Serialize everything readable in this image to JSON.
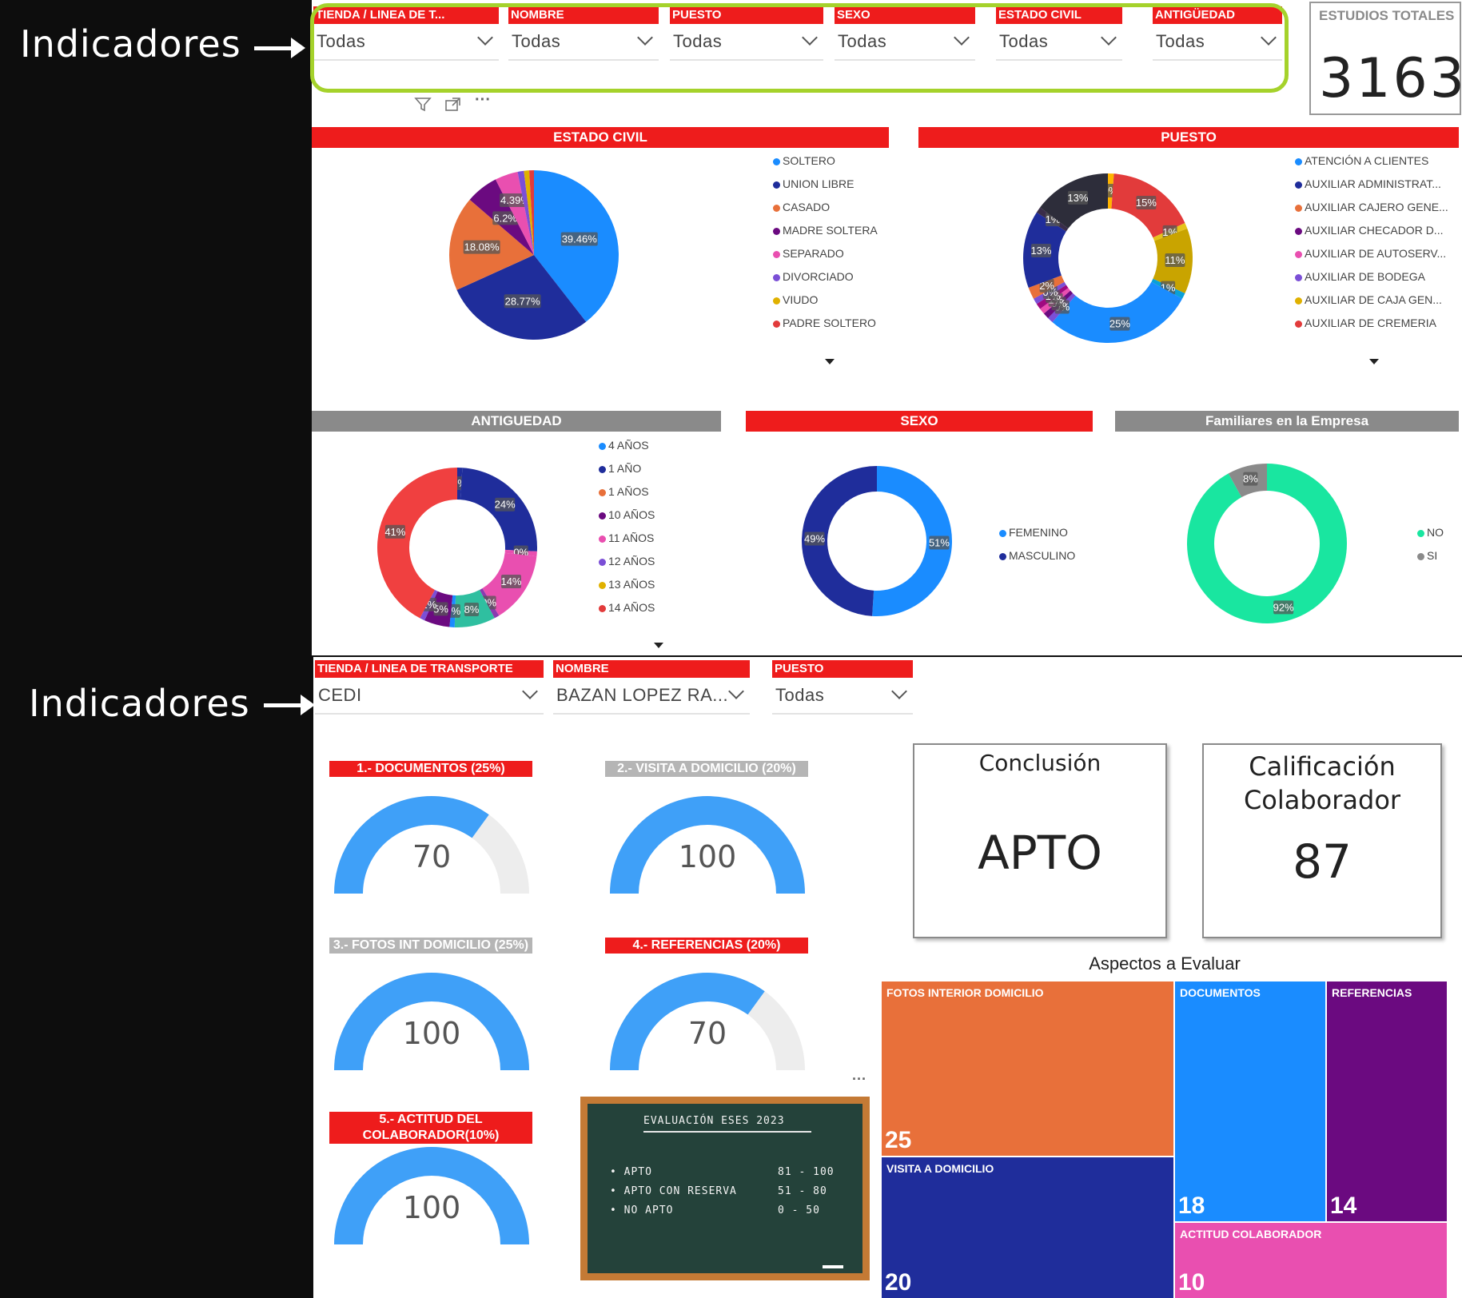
{
  "annotations": {
    "top": "Indicadores",
    "bottom": "Indicadores"
  },
  "top_filters": [
    {
      "header": "TIENDA / LINEA DE T...",
      "value": "Todas"
    },
    {
      "header": "NOMBRE",
      "value": "Todas"
    },
    {
      "header": "PUESTO",
      "value": "Todas"
    },
    {
      "header": "SEXO",
      "value": "Todas"
    },
    {
      "header": "ESTADO CIVIL",
      "value": "Todas"
    },
    {
      "header": "ANTIGÜEDAD",
      "value": "Todas"
    }
  ],
  "estudios": {
    "label": "ESTUDIOS TOTALES",
    "value": "3163"
  },
  "toolbar_more": "···",
  "estado_civil": {
    "title": "ESTADO CIVIL",
    "legend": [
      "SOLTERO",
      "UNION LIBRE",
      "CASADO",
      "MADRE SOLTERA",
      "SEPARADO",
      "DIVORCIADO",
      "VIUDO",
      "PADRE SOLTERO"
    ],
    "colors": [
      "#1a8cff",
      "#1f2d9b",
      "#e8703a",
      "#6b0a80",
      "#e94fb0",
      "#7b4fd6",
      "#e0b100",
      "#e23b3b"
    ],
    "labels": [
      "39.46%",
      "28.77%",
      "18.08%",
      "6.2%",
      "4.39%"
    ]
  },
  "puesto": {
    "title": "PUESTO",
    "legend": [
      "ATENCIÓN A CLIENTES",
      "AUXILIAR ADMINISTRAT...",
      "AUXILIAR CAJERO GENE...",
      "AUXILIAR CHECADOR D...",
      "AUXILIAR DE AUTOSERV...",
      "AUXILIAR DE BODEGA",
      "AUXILIAR DE CAJA GEN...",
      "AUXILIAR DE CREMERIA"
    ],
    "colors": [
      "#1a8cff",
      "#1f2d9b",
      "#e8703a",
      "#6b0a80",
      "#e94fb0",
      "#7b4fd6",
      "#e0b100",
      "#e23b3b"
    ],
    "labels": [
      "0%",
      "15%",
      "1%",
      "11%",
      "1%",
      "25%",
      "0%",
      "0%",
      "1%",
      "1%",
      "0%",
      "2%",
      "13%",
      "1%",
      "13%"
    ]
  },
  "antiguedad": {
    "title": "ANTIGUEDAD",
    "legend": [
      "4 AÑOS",
      "1 AÑO",
      "1 AÑOS",
      "10 AÑOS",
      "11 AÑOS",
      "12 AÑOS",
      "13 AÑOS",
      "14 AÑOS"
    ],
    "colors": [
      "#1a8cff",
      "#1f2d9b",
      "#e8703a",
      "#6b0a80",
      "#e94fb0",
      "#7b4fd6",
      "#e0b100",
      "#e23b3b"
    ],
    "labels": [
      "0%",
      "24%",
      "0%",
      "14%",
      "0%",
      "8%",
      "0%",
      "5%",
      "1%",
      "41%"
    ]
  },
  "sexo": {
    "title": "SEXO",
    "legend": [
      "FEMENINO",
      "MASCULINO"
    ],
    "colors": [
      "#1a8cff",
      "#1f2d9b"
    ],
    "labels": [
      "51%",
      "49%"
    ]
  },
  "familiares": {
    "title": "Familiares en la Empresa",
    "legend": [
      "NO",
      "SI"
    ],
    "colors": [
      "#19e6a0",
      "#8a8a8a"
    ],
    "labels": [
      "92%",
      "8%"
    ]
  },
  "bottom_filters": [
    {
      "header": "TIENDA / LINEA DE TRANSPORTE",
      "value": "CEDI"
    },
    {
      "header": "NOMBRE",
      "value": "BAZAN LOPEZ RA..."
    },
    {
      "header": "PUESTO",
      "value": "Todas"
    }
  ],
  "gauges": [
    {
      "title": "1.- DOCUMENTOS (25%)",
      "value": 70,
      "max": 100,
      "style": "red"
    },
    {
      "title": "2.- VISITA A DOMICILIO (20%)",
      "value": 100,
      "max": 100,
      "style": "gray"
    },
    {
      "title": "3.- FOTOS INT DOMICILIO (25%)",
      "value": 100,
      "max": 100,
      "style": "gray"
    },
    {
      "title": "4.- REFERENCIAS (20%)",
      "value": 70,
      "max": 100,
      "style": "red"
    },
    {
      "title": "5.- ACTITUD DEL COLABORADOR(10%)",
      "value": 100,
      "max": 100,
      "style": "red"
    }
  ],
  "conclusion": {
    "title": "Conclusión",
    "value": "APTO"
  },
  "calificacion": {
    "title": "Calificación Colaborador",
    "value": "87"
  },
  "chalkboard": {
    "title": "EVALUACIÓN ESES 2023",
    "rows": [
      {
        "label": "APTO",
        "range": "81 - 100"
      },
      {
        "label": "APTO CON RESERVA",
        "range": "51 - 80"
      },
      {
        "label": "NO APTO",
        "range": "0 - 50"
      }
    ]
  },
  "treemap": {
    "title": "Aspectos a Evaluar",
    "items": [
      {
        "label": "FOTOS INTERIOR DOMICILIO",
        "value": "25",
        "color": "#e8703a"
      },
      {
        "label": "VISITA A DOMICILIO",
        "value": "20",
        "color": "#1f2d9b"
      },
      {
        "label": "DOCUMENTOS",
        "value": "18",
        "color": "#1a8cff"
      },
      {
        "label": "REFERENCIAS",
        "value": "14",
        "color": "#6b0a80"
      },
      {
        "label": "ACTITUD COLABORADOR",
        "value": "10",
        "color": "#e94fb0"
      }
    ]
  }
}
